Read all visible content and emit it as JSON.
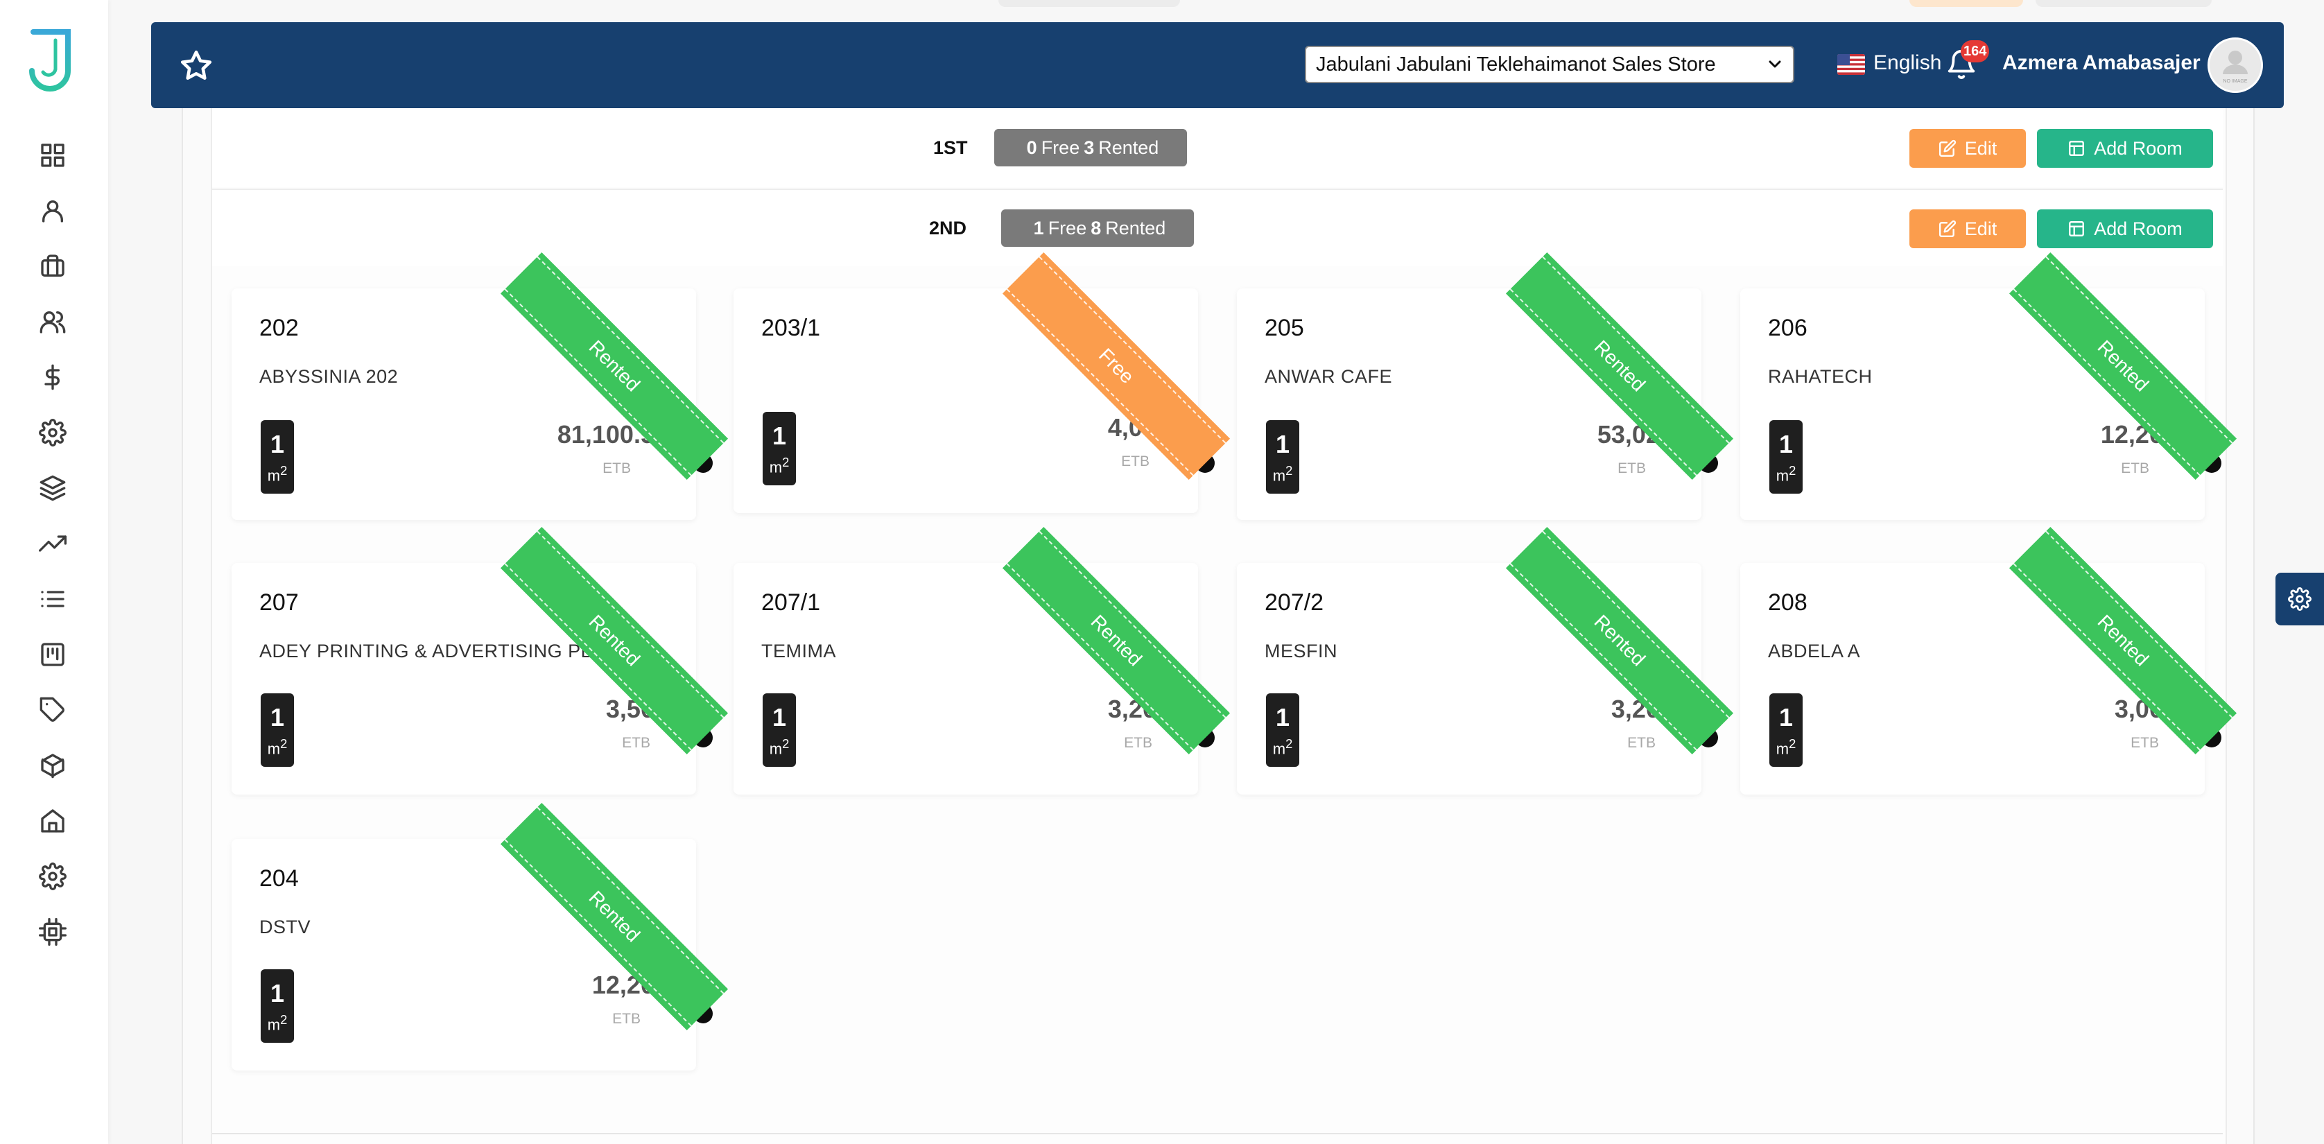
{
  "colors": {
    "header_bg": "#17406f",
    "rented": "#3cc45c",
    "free": "#fb9d4d",
    "edit_button": "#fb9d4d",
    "add_room_button": "#26b58a",
    "pill_bg": "#7a7a7a",
    "notification_badge": "#e53935"
  },
  "sidebar": {
    "items": [
      {
        "icon": "dashboard-grid-icon"
      },
      {
        "icon": "user-icon"
      },
      {
        "icon": "briefcase-icon"
      },
      {
        "icon": "users-icon"
      },
      {
        "icon": "dollar-icon"
      },
      {
        "icon": "settings-gear-icon"
      },
      {
        "icon": "layers-icon"
      },
      {
        "icon": "trending-up-icon"
      },
      {
        "icon": "list-icon"
      },
      {
        "icon": "kanban-board-icon"
      },
      {
        "icon": "tag-icon"
      },
      {
        "icon": "package-box-icon"
      },
      {
        "icon": "home-icon"
      },
      {
        "icon": "settings-icon"
      },
      {
        "icon": "cpu-chip-icon"
      }
    ]
  },
  "header": {
    "store_selected": "Jabulani Jabulani Teklehaimanot Sales Store",
    "language": "English",
    "notifications_count": "164",
    "user_name": "Azmera Amabasajer",
    "avatar_text": "NO IMAGE"
  },
  "floors": [
    {
      "name": "1ST",
      "free": "0",
      "free_label": "Free",
      "rented": "3",
      "rented_label": "Rented",
      "edit_label": "Edit",
      "add_label": "Add Room"
    },
    {
      "name": "2ND",
      "free": "1",
      "free_label": "Free",
      "rented": "8",
      "rented_label": "Rented",
      "edit_label": "Edit",
      "add_label": "Add Room"
    }
  ],
  "rooms": [
    {
      "number": "202",
      "tenant": "ABYSSINIA 202",
      "area": "1",
      "unit": "m",
      "unit_sup": "2",
      "price": "81,100.51",
      "currency": "ETB",
      "status": "Rented"
    },
    {
      "number": "203/1",
      "tenant": "",
      "area": "1",
      "unit": "m",
      "unit_sup": "2",
      "price": "4,000",
      "currency": "ETB",
      "status": "Free"
    },
    {
      "number": "205",
      "tenant": "ANWAR CAFE",
      "area": "1",
      "unit": "m",
      "unit_sup": "2",
      "price": "53,020",
      "currency": "ETB",
      "status": "Rented"
    },
    {
      "number": "206",
      "tenant": "RAHATECH",
      "area": "1",
      "unit": "m",
      "unit_sup": "2",
      "price": "12,200",
      "currency": "ETB",
      "status": "Rented"
    },
    {
      "number": "207",
      "tenant": "ADEY PRINTING & ADVERTISING PLC",
      "area": "1",
      "unit": "m",
      "unit_sup": "2",
      "price": "3,500",
      "currency": "ETB",
      "status": "Rented"
    },
    {
      "number": "207/1",
      "tenant": "TEMIMA",
      "area": "1",
      "unit": "m",
      "unit_sup": "2",
      "price": "3,200",
      "currency": "ETB",
      "status": "Rented"
    },
    {
      "number": "207/2",
      "tenant": "MESFIN",
      "area": "1",
      "unit": "m",
      "unit_sup": "2",
      "price": "3,200",
      "currency": "ETB",
      "status": "Rented"
    },
    {
      "number": "208",
      "tenant": "ABDELA A",
      "area": "1",
      "unit": "m",
      "unit_sup": "2",
      "price": "3,000",
      "currency": "ETB",
      "status": "Rented"
    },
    {
      "number": "204",
      "tenant": "DSTV",
      "area": "1",
      "unit": "m",
      "unit_sup": "2",
      "price": "12,200",
      "currency": "ETB",
      "status": "Rented"
    }
  ]
}
